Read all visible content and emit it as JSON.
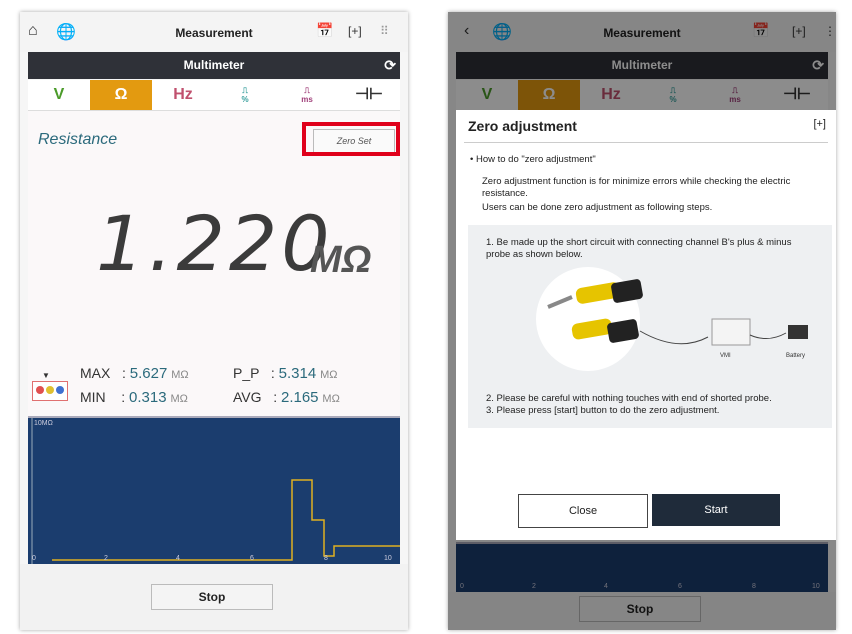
{
  "left": {
    "topbar": {
      "title": "Measurement"
    },
    "subbar": {
      "title": "Multimeter"
    },
    "modes": [
      {
        "label": "V",
        "color": "#4b9b2a"
      },
      {
        "label": "Ω",
        "color": "#ffffff"
      },
      {
        "label": "Hz",
        "color": "#c0506e"
      },
      {
        "label": "%",
        "color": "#3aa09e"
      },
      {
        "label": "ms",
        "color": "#a0407a"
      },
      {
        "label": "⊣⊢",
        "color": "#333333"
      }
    ],
    "reading": {
      "mode_label": "Resistance",
      "zero_set_label": "Zero Set",
      "value": "1.220",
      "unit": "MΩ"
    },
    "stats": {
      "max_label": "MAX",
      "max_sep": ":",
      "max_value": "5.627",
      "max_unit": "MΩ",
      "min_label": "MIN",
      "min_sep": ":",
      "min_value": "0.313",
      "min_unit": "MΩ",
      "pp_label": "P_P",
      "pp_sep": ":",
      "pp_value": "5.314",
      "pp_unit": "MΩ",
      "avg_label": "AVG",
      "avg_sep": ":",
      "avg_value": "2.165",
      "avg_unit": "MΩ"
    },
    "graph": {
      "range_label": "10MΩ",
      "x_ticks": [
        "0",
        "2",
        "4",
        "6",
        "8",
        "10"
      ]
    },
    "stop_label": "Stop"
  },
  "right": {
    "topbar": {
      "title": "Measurement"
    },
    "subbar": {
      "title": "Multimeter"
    },
    "modal": {
      "title": "Zero adjustment",
      "bullet": "How to do \"zero adjustment\"",
      "intro1": "Zero adjustment function is for minimize errors while checking the electric",
      "intro2": "resistance.",
      "intro3": "Users can be done zero adjustment as following steps.",
      "step1a": "1. Be made up the short circuit with connecting channel B's plus & minus",
      "step1b": "probe as shown below.",
      "vmi_label": "VMI",
      "battery_label": "Battery",
      "step2": "2. Please be careful with nothing touches with end of shorted probe.",
      "step3": "3. Please press [start] button to do the zero adjustment.",
      "close_label": "Close",
      "start_label": "Start"
    },
    "graph": {
      "x_ticks": [
        "0",
        "2",
        "4",
        "6",
        "8",
        "10"
      ]
    },
    "stop_label": "Stop"
  }
}
